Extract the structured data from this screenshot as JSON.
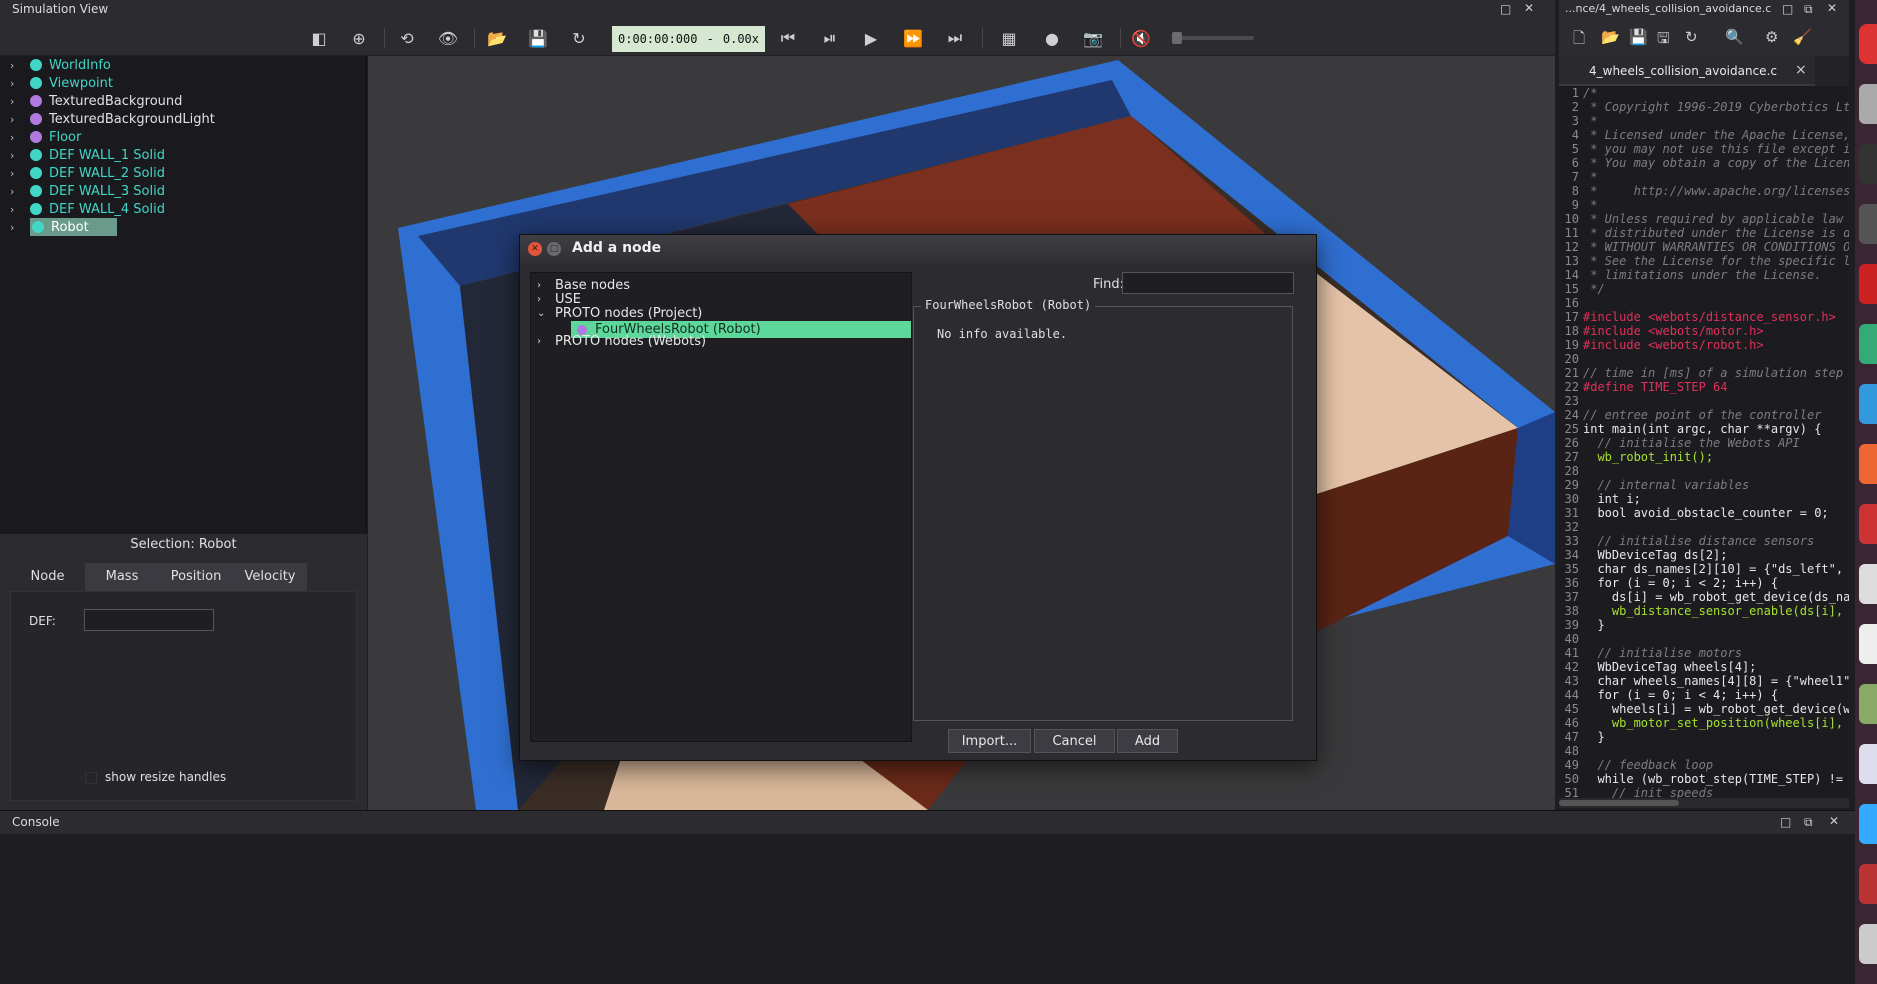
{
  "sim_view": {
    "title": "Simulation View",
    "time": "0:00:00:000",
    "time_sep": "-",
    "speed": "0.00x"
  },
  "scene_tree": {
    "items": [
      {
        "label": "WorldInfo",
        "color": "#42d6c6"
      },
      {
        "label": "Viewpoint",
        "color": "#42d6c6"
      },
      {
        "label": "TexturedBackground",
        "color": "#b07ae0"
      },
      {
        "label": "TexturedBackgroundLight",
        "color": "#b07ae0"
      },
      {
        "label": "Floor",
        "color": "#b07ae0"
      },
      {
        "label": "DEF WALL_1 Solid",
        "color": "#42d6c6"
      },
      {
        "label": "DEF WALL_2 Solid",
        "color": "#42d6c6"
      },
      {
        "label": "DEF WALL_3 Solid",
        "color": "#42d6c6"
      },
      {
        "label": "DEF WALL_4 Solid",
        "color": "#42d6c6"
      },
      {
        "label": "Robot",
        "color": "#42d6c6"
      }
    ]
  },
  "field_editor": {
    "selection": "Selection: Robot",
    "tabs": [
      "Node",
      "Mass",
      "Position",
      "Velocity"
    ],
    "def_label": "DEF:",
    "def_value": "",
    "resize_handles": "show resize handles"
  },
  "editor": {
    "title": "...nce/4_wheels_collision_avoidance.c",
    "tab_name": "4_wheels_collision_avoidance.c",
    "close": "×"
  },
  "console": {
    "title": "Console"
  },
  "dialog": {
    "title": "Add a node",
    "tree": [
      "Base nodes",
      "USE",
      "PROTO nodes (Project)",
      "FourWheelsRobot (Robot)",
      "PROTO nodes (Webots)"
    ],
    "find_label": "Find:",
    "find_value": "",
    "info_title": "FourWheelsRobot (Robot)",
    "info_text": "No info available.",
    "buttons": {
      "import": "Import...",
      "cancel": "Cancel",
      "add": "Add"
    }
  },
  "code_lines": [
    {
      "n": "1",
      "t": "/*",
      "c": "com"
    },
    {
      "n": "2",
      "t": " * Copyright 1996-2019 Cyberbotics Lt",
      "c": "com"
    },
    {
      "n": "3",
      "t": " *",
      "c": "com"
    },
    {
      "n": "4",
      "t": " * Licensed under the Apache License,",
      "c": "com"
    },
    {
      "n": "5",
      "t": " * you may not use this file except i",
      "c": "com"
    },
    {
      "n": "6",
      "t": " * You may obtain a copy of the Licen",
      "c": "com"
    },
    {
      "n": "7",
      "t": " *",
      "c": "com"
    },
    {
      "n": "8",
      "t": " *     http://www.apache.org/licenses",
      "c": "com"
    },
    {
      "n": "9",
      "t": " *",
      "c": "com"
    },
    {
      "n": "10",
      "t": " * Unless required by applicable law ",
      "c": "com"
    },
    {
      "n": "11",
      "t": " * distributed under the License is d",
      "c": "com"
    },
    {
      "n": "12",
      "t": " * WITHOUT WARRANTIES OR CONDITIONS O",
      "c": "com"
    },
    {
      "n": "13",
      "t": " * See the License for the specific l",
      "c": "com"
    },
    {
      "n": "14",
      "t": " * limitations under the License.",
      "c": "com"
    },
    {
      "n": "15",
      "t": " */",
      "c": "com"
    },
    {
      "n": "16",
      "t": "",
      "c": "plain"
    },
    {
      "n": "17",
      "t": "#include <webots/distance_sensor.h>",
      "c": "pre"
    },
    {
      "n": "18",
      "t": "#include <webots/motor.h>",
      "c": "pre"
    },
    {
      "n": "19",
      "t": "#include <webots/robot.h>",
      "c": "pre"
    },
    {
      "n": "20",
      "t": "",
      "c": "plain"
    },
    {
      "n": "21",
      "t": "// time in [ms] of a simulation step",
      "c": "com"
    },
    {
      "n": "22",
      "t": "#define TIME_STEP 64",
      "c": "pre"
    },
    {
      "n": "23",
      "t": "",
      "c": "plain"
    },
    {
      "n": "24",
      "t": "// entree point of the controller",
      "c": "com"
    },
    {
      "n": "25",
      "t": "int main(int argc, char **argv) {",
      "c": "plain"
    },
    {
      "n": "26",
      "t": "  // initialise the Webots API",
      "c": "com"
    },
    {
      "n": "27",
      "t": "  wb_robot_init();",
      "c": "fn"
    },
    {
      "n": "28",
      "t": "",
      "c": "plain"
    },
    {
      "n": "29",
      "t": "  // internal variables",
      "c": "com"
    },
    {
      "n": "30",
      "t": "  int i;",
      "c": "plain"
    },
    {
      "n": "31",
      "t": "  bool avoid_obstacle_counter = 0;",
      "c": "plain"
    },
    {
      "n": "32",
      "t": "",
      "c": "plain"
    },
    {
      "n": "33",
      "t": "  // initialise distance sensors",
      "c": "com"
    },
    {
      "n": "34",
      "t": "  WbDeviceTag ds[2];",
      "c": "plain"
    },
    {
      "n": "35",
      "t": "  char ds_names[2][10] = {\"ds_left\",",
      "c": "plain"
    },
    {
      "n": "36",
      "t": "  for (i = 0; i < 2; i++) {",
      "c": "plain"
    },
    {
      "n": "37",
      "t": "    ds[i] = wb_robot_get_device(ds_na",
      "c": "plain"
    },
    {
      "n": "38",
      "t": "    wb_distance_sensor_enable(ds[i], ",
      "c": "fn"
    },
    {
      "n": "39",
      "t": "  }",
      "c": "plain"
    },
    {
      "n": "40",
      "t": "",
      "c": "plain"
    },
    {
      "n": "41",
      "t": "  // initialise motors",
      "c": "com"
    },
    {
      "n": "42",
      "t": "  WbDeviceTag wheels[4];",
      "c": "plain"
    },
    {
      "n": "43",
      "t": "  char wheels_names[4][8] = {\"wheel1\"",
      "c": "plain"
    },
    {
      "n": "44",
      "t": "  for (i = 0; i < 4; i++) {",
      "c": "plain"
    },
    {
      "n": "45",
      "t": "    wheels[i] = wb_robot_get_device(w",
      "c": "plain"
    },
    {
      "n": "46",
      "t": "    wb_motor_set_position(wheels[i],",
      "c": "fn"
    },
    {
      "n": "47",
      "t": "  }",
      "c": "plain"
    },
    {
      "n": "48",
      "t": "",
      "c": "plain"
    },
    {
      "n": "49",
      "t": "  // feedback loop",
      "c": "com"
    },
    {
      "n": "50",
      "t": "  while (wb_robot_step(TIME_STEP) != ",
      "c": "plain"
    },
    {
      "n": "51",
      "t": "    // init speeds",
      "c": "com"
    }
  ]
}
